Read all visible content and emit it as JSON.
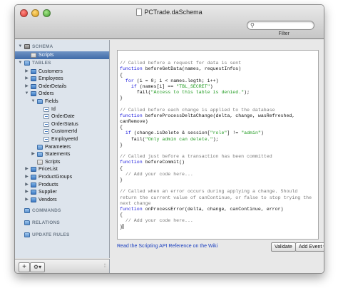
{
  "window": {
    "title": "PCTrade.daSchema"
  },
  "search": {
    "placeholder": "",
    "filter_label": "Filter"
  },
  "sidebar": {
    "rows": [
      {
        "kind": "section",
        "label": "SCHEMA",
        "indent": 0,
        "expanded": true,
        "icon": "schema"
      },
      {
        "kind": "item",
        "label": "Scripts",
        "indent": 1,
        "icon": "script",
        "selected": true
      },
      {
        "kind": "section",
        "label": "TABLES",
        "indent": 0,
        "expanded": true,
        "icon": "folder"
      },
      {
        "kind": "item",
        "label": "Customers",
        "indent": 1,
        "expanded": false,
        "icon": "table"
      },
      {
        "kind": "item",
        "label": "Employees",
        "indent": 1,
        "expanded": false,
        "icon": "table"
      },
      {
        "kind": "item",
        "label": "OrderDetails",
        "indent": 1,
        "expanded": false,
        "icon": "table"
      },
      {
        "kind": "item",
        "label": "Orders",
        "indent": 1,
        "expanded": true,
        "icon": "table"
      },
      {
        "kind": "item",
        "label": "Fields",
        "indent": 2,
        "expanded": true,
        "icon": "folder"
      },
      {
        "kind": "item",
        "label": "Id",
        "indent": 3,
        "icon": "field"
      },
      {
        "kind": "item",
        "label": "OrderDate",
        "indent": 3,
        "icon": "field"
      },
      {
        "kind": "item",
        "label": "OrderStatus",
        "indent": 3,
        "icon": "field"
      },
      {
        "kind": "item",
        "label": "CustomerId",
        "indent": 3,
        "icon": "field"
      },
      {
        "kind": "item",
        "label": "EmployeeId",
        "indent": 3,
        "icon": "field"
      },
      {
        "kind": "item",
        "label": "Parameters",
        "indent": 2,
        "icon": "folder"
      },
      {
        "kind": "item",
        "label": "Statements",
        "indent": 2,
        "expanded": false,
        "icon": "folder"
      },
      {
        "kind": "item",
        "label": "Scripts",
        "indent": 2,
        "icon": "script"
      },
      {
        "kind": "item",
        "label": "PriceList",
        "indent": 1,
        "expanded": false,
        "icon": "table"
      },
      {
        "kind": "item",
        "label": "ProductGroups",
        "indent": 1,
        "expanded": false,
        "icon": "table"
      },
      {
        "kind": "item",
        "label": "Products",
        "indent": 1,
        "expanded": false,
        "icon": "table"
      },
      {
        "kind": "item",
        "label": "Supplier",
        "indent": 1,
        "expanded": false,
        "icon": "table"
      },
      {
        "kind": "item",
        "label": "Vendors",
        "indent": 1,
        "expanded": false,
        "icon": "table"
      },
      {
        "kind": "section",
        "label": "COMMANDS",
        "indent": 0,
        "icon": "folder",
        "gap": true
      },
      {
        "kind": "section",
        "label": "RELATIONS",
        "indent": 0,
        "icon": "folder",
        "gap": true
      },
      {
        "kind": "section",
        "label": "UPDATE RULES",
        "indent": 0,
        "icon": "folder",
        "gap": true
      }
    ]
  },
  "bottom_bar": {
    "add_label": "+",
    "action_label": "⚙▾",
    "grip": "⦙⦙"
  },
  "editor": {
    "lines": [
      [],
      [
        [
          "c",
          "// Called before a request for data is sent"
        ]
      ],
      [
        [
          "k",
          "function"
        ],
        [
          "p",
          " beforeGetData(names, requestInfos)"
        ]
      ],
      [
        [
          "p",
          "{"
        ]
      ],
      [
        [
          "p",
          "  "
        ],
        [
          "k",
          "for"
        ],
        [
          "p",
          " (i = 0; i < names.legth; i++)"
        ]
      ],
      [
        [
          "p",
          "    "
        ],
        [
          "k",
          "if"
        ],
        [
          "p",
          " (names[i] == "
        ],
        [
          "s",
          "\"TBL_SECRET\""
        ],
        [
          "p",
          ")"
        ]
      ],
      [
        [
          "p",
          "      fail("
        ],
        [
          "s",
          "\"Access to this table is denied.\""
        ],
        [
          "p",
          ");"
        ]
      ],
      [
        [
          "p",
          "}"
        ]
      ],
      [],
      [
        [
          "c",
          "// Called before each change is applied to the database"
        ]
      ],
      [
        [
          "k",
          "function"
        ],
        [
          "p",
          " beforeProcessDeltaChange(delta, change, wasRefreshed,"
        ]
      ],
      [
        [
          "p",
          "canRemove)"
        ]
      ],
      [
        [
          "p",
          "{"
        ]
      ],
      [
        [
          "p",
          "  "
        ],
        [
          "k",
          "if"
        ],
        [
          "p",
          " (change.isDelete & session["
        ],
        [
          "s",
          "\"role\""
        ],
        [
          "p",
          "] != "
        ],
        [
          "s",
          "\"admin\""
        ],
        [
          "p",
          ")"
        ]
      ],
      [
        [
          "p",
          "    fail("
        ],
        [
          "s",
          "\"Only admin can delete.\""
        ],
        [
          "p",
          ");"
        ]
      ],
      [
        [
          "p",
          "}"
        ]
      ],
      [],
      [
        [
          "c",
          "// Called just before a transaction has been committed"
        ]
      ],
      [
        [
          "k",
          "function"
        ],
        [
          "p",
          " beforeCommit()"
        ]
      ],
      [
        [
          "p",
          "{"
        ]
      ],
      [
        [
          "p",
          "  "
        ],
        [
          "c",
          "// Add your code here..."
        ]
      ],
      [
        [
          "p",
          "}"
        ]
      ],
      [],
      [
        [
          "c",
          "// Called when an error occurs during applying a change. Should"
        ]
      ],
      [
        [
          "c",
          "return the current value of canContinue, or false to stop trying the"
        ]
      ],
      [
        [
          "c",
          "next change"
        ]
      ],
      [
        [
          "k",
          "function"
        ],
        [
          "p",
          " onProcessError(delta, change, canContinue, error)"
        ]
      ],
      [
        [
          "p",
          "{"
        ]
      ],
      [
        [
          "p",
          "  "
        ],
        [
          "c",
          "// Add your code here..."
        ]
      ],
      [
        [
          "p",
          "}"
        ],
        [
          "caret",
          ""
        ]
      ]
    ]
  },
  "footer": {
    "wiki_link": "Read the Scripting API Reference on the Wiki",
    "validate_label": "Validate",
    "add_event_label": "Add Event ▾"
  },
  "colors": {
    "comment": "#7a7a7a",
    "keyword": "#1a1adc",
    "string": "#1f9a1f",
    "link": "#1a3fc0",
    "selection": "#3f6aa8"
  }
}
